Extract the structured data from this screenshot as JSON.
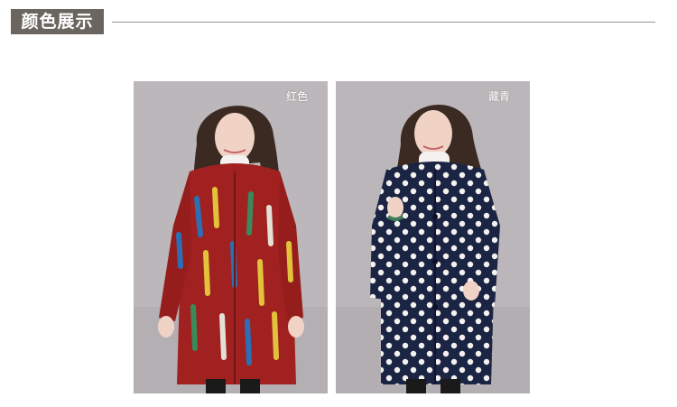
{
  "section": {
    "title": "颜色展示"
  },
  "cards": [
    {
      "label": "红色",
      "coat_color": "#a0211f",
      "pattern": "feather"
    },
    {
      "label": "藏青",
      "coat_color": "#1c2443",
      "pattern": "polka-dot"
    }
  ],
  "colors": {
    "header_box": "#6a655e",
    "header_line": "#9a948c",
    "photo_background": "#b9b5b8"
  }
}
